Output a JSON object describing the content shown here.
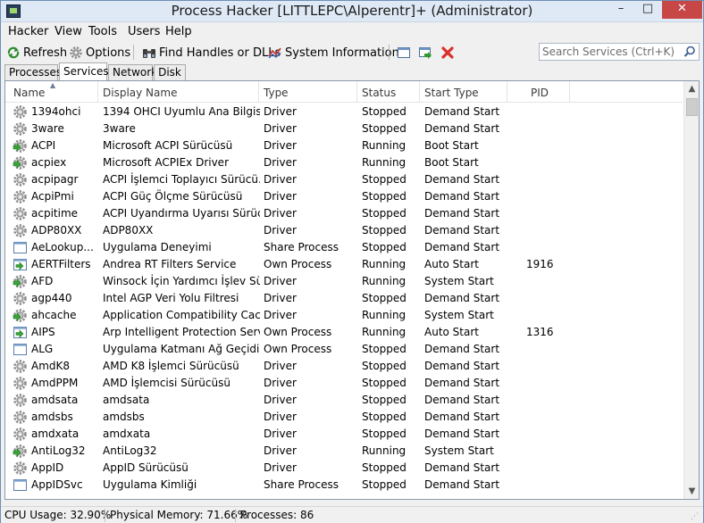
{
  "window": {
    "title": "Process Hacker [LITTLEPC\\Alperentr]+ (Administrator)",
    "minimize": "–",
    "maximize": "□",
    "close": "✕"
  },
  "menu": [
    "Hacker",
    "View",
    "Tools",
    "Users",
    "Help"
  ],
  "toolbar": {
    "refresh": "Refresh",
    "options": "Options",
    "find_handles": "Find Handles or DLLs",
    "system_info": "System Information",
    "search_placeholder": "Search Services (Ctrl+K)"
  },
  "tabs": [
    "Processes",
    "Services",
    "Network",
    "Disk"
  ],
  "active_tab": "Services",
  "columns": [
    "Name",
    "Display Name",
    "Type",
    "Status",
    "Start Type",
    "PID"
  ],
  "rows": [
    {
      "icon": "gear",
      "name": "1394ohci",
      "display": "1394 OHCI Uyumlu Ana Bilgis...",
      "type": "Driver",
      "status": "Stopped",
      "start": "Demand Start",
      "pid": ""
    },
    {
      "icon": "gear",
      "name": "3ware",
      "display": "3ware",
      "type": "Driver",
      "status": "Stopped",
      "start": "Demand Start",
      "pid": ""
    },
    {
      "icon": "gear-running",
      "name": "ACPI",
      "display": "Microsoft ACPI Sürücüsü",
      "type": "Driver",
      "status": "Running",
      "start": "Boot Start",
      "pid": ""
    },
    {
      "icon": "gear-running",
      "name": "acpiex",
      "display": "Microsoft ACPIEx Driver",
      "type": "Driver",
      "status": "Running",
      "start": "Boot Start",
      "pid": ""
    },
    {
      "icon": "gear",
      "name": "acpipagr",
      "display": "ACPI İşlemci Toplayıcı Sürücü...",
      "type": "Driver",
      "status": "Stopped",
      "start": "Demand Start",
      "pid": ""
    },
    {
      "icon": "gear",
      "name": "AcpiPmi",
      "display": "ACPI Güç Ölçme Sürücüsü",
      "type": "Driver",
      "status": "Stopped",
      "start": "Demand Start",
      "pid": ""
    },
    {
      "icon": "gear",
      "name": "acpitime",
      "display": "ACPI Uyandırma Uyarısı Sürüc...",
      "type": "Driver",
      "status": "Stopped",
      "start": "Demand Start",
      "pid": ""
    },
    {
      "icon": "gear",
      "name": "ADP80XX",
      "display": "ADP80XX",
      "type": "Driver",
      "status": "Stopped",
      "start": "Demand Start",
      "pid": ""
    },
    {
      "icon": "window",
      "name": "AeLookup...",
      "display": "Uygulama Deneyimi",
      "type": "Share Process",
      "status": "Stopped",
      "start": "Demand Start",
      "pid": ""
    },
    {
      "icon": "window-running",
      "name": "AERTFilters",
      "display": "Andrea RT Filters Service",
      "type": "Own Process",
      "status": "Running",
      "start": "Auto Start",
      "pid": "1916"
    },
    {
      "icon": "gear-running",
      "name": "AFD",
      "display": "Winsock İçin Yardımcı İşlev Sü...",
      "type": "Driver",
      "status": "Running",
      "start": "System Start",
      "pid": ""
    },
    {
      "icon": "gear",
      "name": "agp440",
      "display": "Intel AGP Veri Yolu Filtresi",
      "type": "Driver",
      "status": "Stopped",
      "start": "Demand Start",
      "pid": ""
    },
    {
      "icon": "gear-running",
      "name": "ahcache",
      "display": "Application Compatibility Cac...",
      "type": "Driver",
      "status": "Running",
      "start": "System Start",
      "pid": ""
    },
    {
      "icon": "window-running",
      "name": "AIPS",
      "display": "Arp Intelligent Protection Serv...",
      "type": "Own Process",
      "status": "Running",
      "start": "Auto Start",
      "pid": "1316"
    },
    {
      "icon": "window",
      "name": "ALG",
      "display": "Uygulama Katmanı Ağ Geçidi ...",
      "type": "Own Process",
      "status": "Stopped",
      "start": "Demand Start",
      "pid": ""
    },
    {
      "icon": "gear",
      "name": "AmdK8",
      "display": "AMD K8 İşlemci Sürücüsü",
      "type": "Driver",
      "status": "Stopped",
      "start": "Demand Start",
      "pid": ""
    },
    {
      "icon": "gear",
      "name": "AmdPPM",
      "display": "AMD İşlemcisi Sürücüsü",
      "type": "Driver",
      "status": "Stopped",
      "start": "Demand Start",
      "pid": ""
    },
    {
      "icon": "gear",
      "name": "amdsata",
      "display": "amdsata",
      "type": "Driver",
      "status": "Stopped",
      "start": "Demand Start",
      "pid": ""
    },
    {
      "icon": "gear",
      "name": "amdsbs",
      "display": "amdsbs",
      "type": "Driver",
      "status": "Stopped",
      "start": "Demand Start",
      "pid": ""
    },
    {
      "icon": "gear",
      "name": "amdxata",
      "display": "amdxata",
      "type": "Driver",
      "status": "Stopped",
      "start": "Demand Start",
      "pid": ""
    },
    {
      "icon": "gear-running",
      "name": "AntiLog32",
      "display": "AntiLog32",
      "type": "Driver",
      "status": "Running",
      "start": "System Start",
      "pid": ""
    },
    {
      "icon": "gear",
      "name": "AppID",
      "display": "AppID Sürücüsü",
      "type": "Driver",
      "status": "Stopped",
      "start": "Demand Start",
      "pid": ""
    },
    {
      "icon": "window",
      "name": "AppIDSvc",
      "display": "Uygulama Kimliği",
      "type": "Share Process",
      "status": "Stopped",
      "start": "Demand Start",
      "pid": ""
    }
  ],
  "statusbar": {
    "cpu": "CPU Usage: 32.90%",
    "memory": "Physical Memory: 71.66%",
    "processes": "Processes: 86"
  },
  "colors": {
    "window_border": "#6d8fb5",
    "titlebar": "#dfe9f5",
    "close_button": "#c74646",
    "running_arrow": "#3aa33a",
    "delete_red": "#d9302b"
  }
}
